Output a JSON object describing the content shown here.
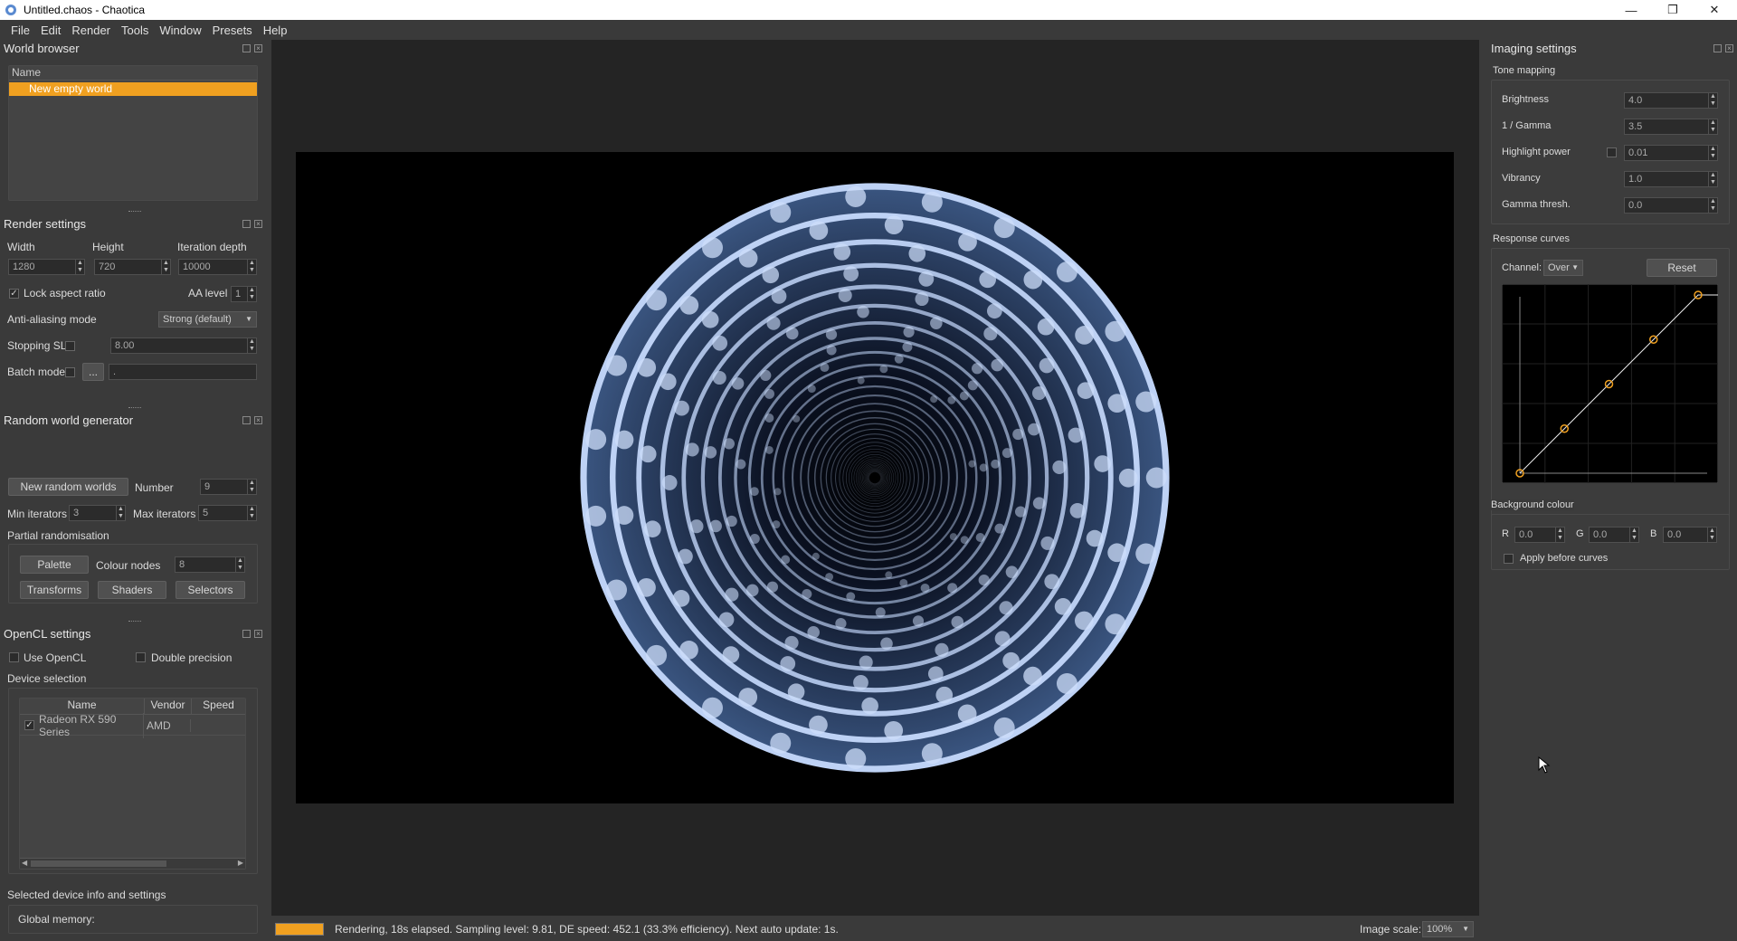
{
  "window": {
    "title": "Untitled.chaos - Chaotica",
    "minimize": "—",
    "restore": "❐",
    "close": "✕"
  },
  "menu": [
    "File",
    "Edit",
    "Render",
    "Tools",
    "Window",
    "Presets",
    "Help"
  ],
  "world_browser": {
    "title": "World browser",
    "col_name": "Name",
    "selected_item": "New empty world"
  },
  "render_settings": {
    "title": "Render settings",
    "width_label": "Width",
    "height_label": "Height",
    "depth_label": "Iteration depth",
    "width": "1280",
    "height": "720",
    "depth": "10000",
    "lock_aspect_label": "Lock aspect ratio",
    "lock_aspect_checked": "✓",
    "aa_level_label": "AA level",
    "aa_level": "1",
    "aa_mode_label": "Anti-aliasing mode",
    "aa_mode": "Strong (default)",
    "stopping_sl_label": "Stopping SL",
    "stopping_sl": "8.00",
    "batch_mode_label": "Batch mode",
    "batch_browse": "...",
    "batch_path": "."
  },
  "random_world": {
    "title": "Random world generator",
    "new_button": "New random worlds",
    "number_label": "Number",
    "number": "9",
    "min_iter_label": "Min iterators",
    "min_iter": "3",
    "max_iter_label": "Max iterators",
    "max_iter": "5",
    "partial_label": "Partial randomisation",
    "palette_button": "Palette",
    "colour_nodes_label": "Colour nodes",
    "colour_nodes": "8",
    "transforms_button": "Transforms",
    "shaders_button": "Shaders",
    "selectors_button": "Selectors"
  },
  "opencl": {
    "title": "OpenCL settings",
    "use_opencl_label": "Use OpenCL",
    "double_precision_label": "Double precision",
    "device_selection_label": "Device selection",
    "columns": [
      "Name",
      "Vendor",
      "Speed"
    ],
    "device": {
      "checked": "✓",
      "name": "Radeon RX 590 Series",
      "vendor": "AMD",
      "speed": ""
    },
    "selected_info_label": "Selected device info and settings",
    "global_memory_label": "Global memory:"
  },
  "status": {
    "progress": 1.0,
    "text": "Rendering, 18s elapsed. Sampling level: 9.81, DE speed: 452.1 (33.3% efficiency). Next auto update: 1s.",
    "image_scale_label": "Image scale:",
    "image_scale": "100%"
  },
  "imaging": {
    "title": "Imaging settings",
    "tone_mapping_label": "Tone mapping",
    "brightness_label": "Brightness",
    "brightness": "4.0",
    "gamma_label": "1 / Gamma",
    "gamma": "3.5",
    "highlight_label": "Highlight power",
    "highlight": "0.01",
    "vibrancy_label": "Vibrancy",
    "vibrancy": "1.0",
    "gamma_thresh_label": "Gamma thresh.",
    "gamma_thresh": "0.0",
    "response_curves_label": "Response curves",
    "channel_label": "Channel:",
    "channel": "Over",
    "reset_button": "Reset",
    "curve_points": [
      [
        0,
        0
      ],
      [
        0.25,
        0.25
      ],
      [
        0.5,
        0.5
      ],
      [
        0.75,
        0.75
      ],
      [
        1,
        1
      ]
    ],
    "background_label": "Background colour",
    "r_label": "R",
    "r": "0.0",
    "g_label": "G",
    "g": "0.0",
    "b_label": "B",
    "b": "0.0",
    "apply_before_label": "Apply before curves"
  },
  "colors": {
    "accent": "#f0a020",
    "panel": "#3a3a3a",
    "viewport": "#242424",
    "fractal": "#a8c4f0"
  }
}
